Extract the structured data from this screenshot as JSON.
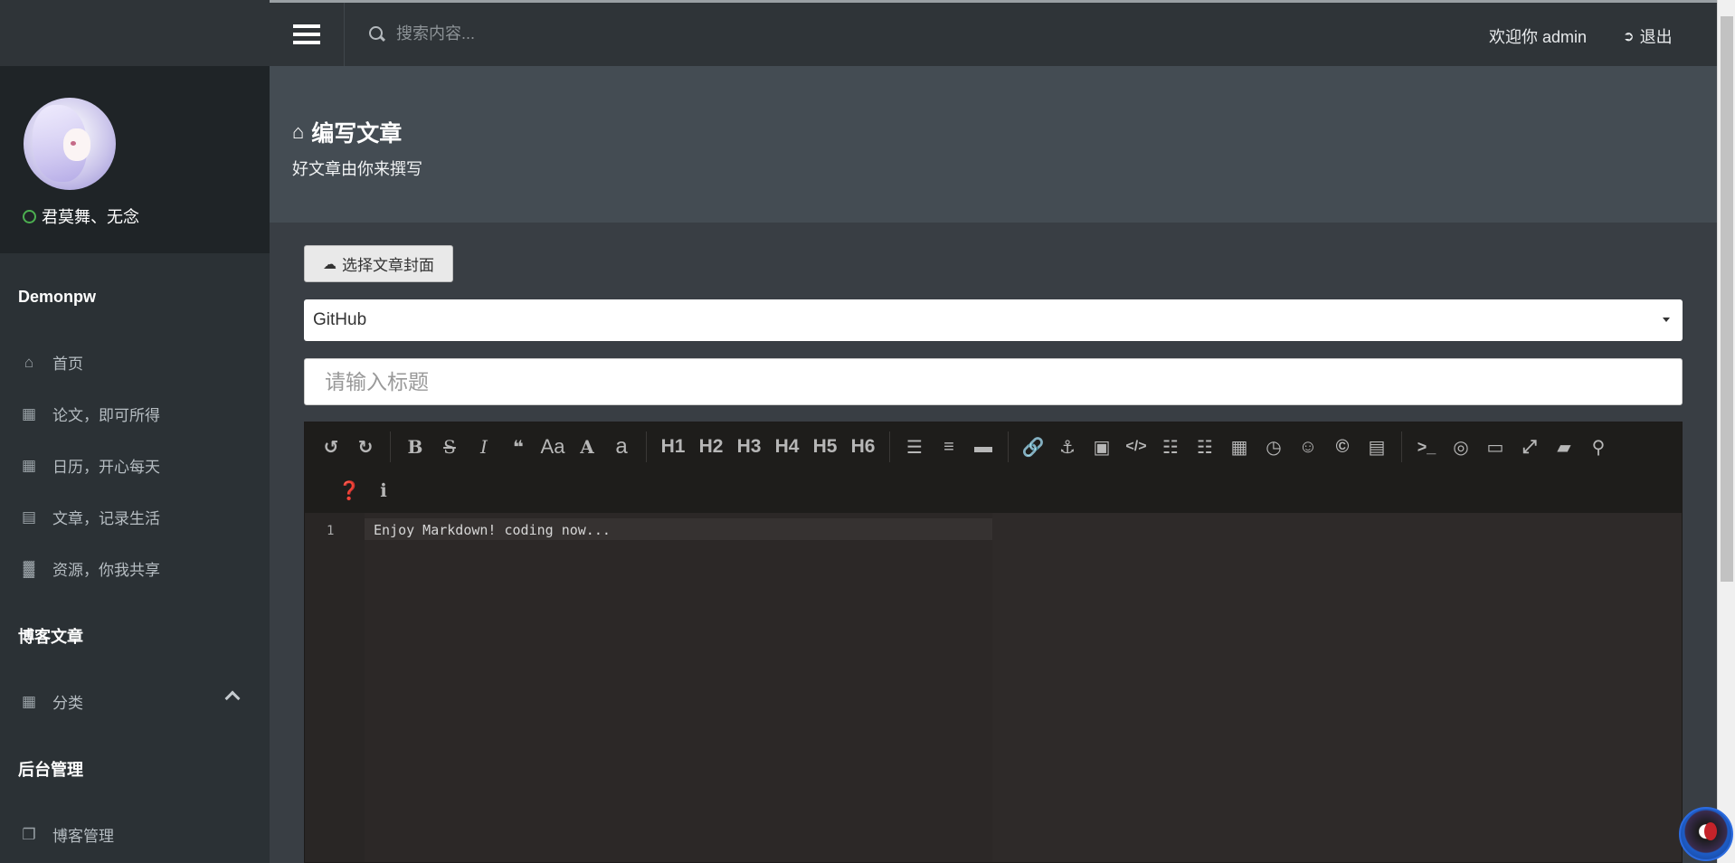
{
  "topbar": {
    "search_placeholder": "搜索内容...",
    "welcome": "欢迎你 admin",
    "logout_label": "退出"
  },
  "sidebar": {
    "user": {
      "name": "君莫舞、无念"
    },
    "section1": "Demonpw",
    "items1": [
      {
        "label": "首页",
        "icon": "home-icon"
      },
      {
        "label": "论文，即可所得",
        "icon": "table-icon"
      },
      {
        "label": "日历，开心每天",
        "icon": "calendar-icon"
      },
      {
        "label": "文章，记录生活",
        "icon": "calculator-icon"
      },
      {
        "label": "资源，你我共享",
        "icon": "bar-chart-icon"
      }
    ],
    "section2": "博客文章",
    "items2": [
      {
        "label": "分类",
        "icon": "table-icon"
      }
    ],
    "section3": "后台管理",
    "items3": [
      {
        "label": "博客管理",
        "icon": "copy-icon"
      }
    ]
  },
  "page": {
    "title": "编写文章",
    "subtitle": "好文章由你来撰写"
  },
  "form": {
    "cover_button": "选择文章封面",
    "category_selected": "GitHub",
    "title_placeholder": "请输入标题"
  },
  "editor": {
    "toolbar": {
      "headings": [
        "H1",
        "H2",
        "H3",
        "H4",
        "H5",
        "H6"
      ],
      "letters": {
        "bold": "B",
        "italic": "I",
        "case": "Aa",
        "upper": "A",
        "lower": "a"
      }
    },
    "line_number": "1",
    "content": "Enjoy Markdown! coding now..."
  },
  "colors": {
    "sidebar_bg": "#2b3135",
    "topbar_bg": "#2f3438",
    "header_bg": "#444c53",
    "editor_bg": "#2e2a29",
    "status_online": "#4caf50"
  }
}
